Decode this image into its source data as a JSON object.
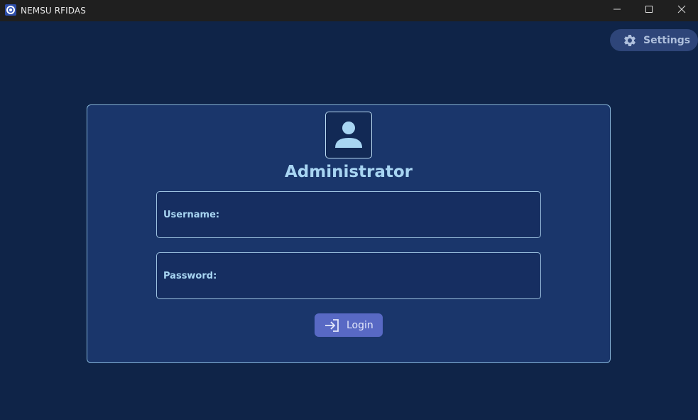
{
  "window": {
    "title": "NEMSU RFIDAS",
    "app_icon": "app-logo-icon",
    "controls": {
      "minimize": "minimize-icon",
      "maximize": "maximize-icon",
      "close": "close-icon"
    }
  },
  "header": {
    "settings_label": "Settings",
    "settings_icon": "gear-icon"
  },
  "login_card": {
    "avatar_icon": "user-avatar-icon",
    "title": "Administrator",
    "username": {
      "label": "Username:",
      "value": ""
    },
    "password": {
      "label": "Password:",
      "value": ""
    },
    "login_button": {
      "label": "Login",
      "icon": "login-arrow-icon"
    }
  },
  "colors": {
    "titlebar": "#1f1f1f",
    "background": "#0f2448",
    "card": "#1a366b",
    "accent_text": "#a8d5f2",
    "button": "#5869c4",
    "settings_button": "#2e4579"
  }
}
